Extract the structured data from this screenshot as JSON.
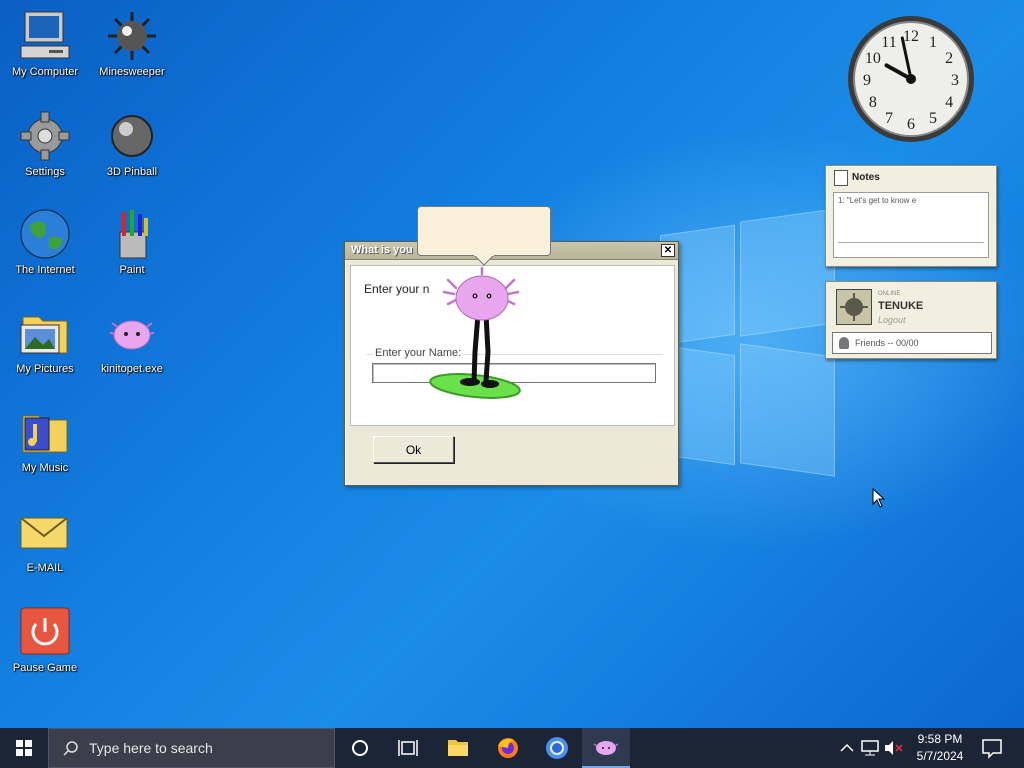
{
  "desktop": {
    "icons": [
      {
        "label": "My Computer",
        "icon": "computer-icon"
      },
      {
        "label": "Minesweeper",
        "icon": "mine-icon"
      },
      {
        "label": "Settings",
        "icon": "gear-icon"
      },
      {
        "label": "3D Pinball",
        "icon": "pinball-icon"
      },
      {
        "label": "The Internet",
        "icon": "globe-icon"
      },
      {
        "label": "Paint",
        "icon": "paint-icon"
      },
      {
        "label": "My Pictures",
        "icon": "pictures-folder-icon"
      },
      {
        "label": "kinitopet.exe",
        "icon": "critter-icon"
      },
      {
        "label": "My Music",
        "icon": "music-folder-icon"
      },
      {
        "label": "E-MAIL",
        "icon": "envelope-icon"
      },
      {
        "label": "Pause Game",
        "icon": "power-icon"
      }
    ]
  },
  "clock": {
    "numbers": [
      "12",
      "1",
      "2",
      "3",
      "4",
      "5",
      "6",
      "7",
      "8",
      "9",
      "10",
      "11"
    ],
    "hour": 9.97,
    "minute": 58
  },
  "notes": {
    "title": "Notes",
    "text": "1: \"Let's get to know e"
  },
  "user_widget": {
    "status": "ONLINE",
    "name": "TENUKE",
    "logout": "Logout",
    "friends": "Friends -- 00/00"
  },
  "dialog": {
    "title": "What is you",
    "close": "✕",
    "prompt": "Enter your n",
    "name_label": "Enter your Name:",
    "name_value": "",
    "ok": "Ok"
  },
  "taskbar": {
    "search_placeholder": "Type here to search",
    "time": "9:58 PM",
    "date": "5/7/2024"
  },
  "colors": {
    "desktop": "#0a6fd6",
    "taskbar": "#1c2535",
    "critter": "#e8a6ee",
    "board": "#6ae04a"
  }
}
